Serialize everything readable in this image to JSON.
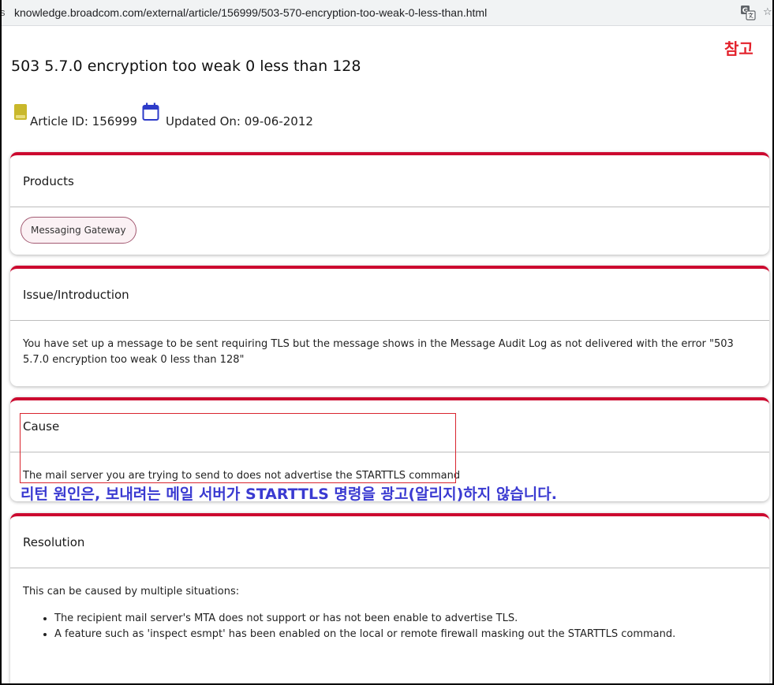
{
  "browser": {
    "url": "knowledge.broadcom.com/external/article/156999/503-570-encryption-too-weak-0-less-than.html",
    "edge_char": "s",
    "translate_icon": "translate-icon",
    "bookmark_icon": "star-icon"
  },
  "annotation": {
    "ref_label": "참고",
    "korean_note": "리턴 원인은, 보내려는 메일 서버가 STARTTLS 명령을 광고(알리지)하지 않습니다.",
    "box_color": "#d9252f",
    "note_color": "#3a3ad1"
  },
  "article": {
    "title": "503 5.7.0 encryption too weak 0 less than 128",
    "article_id": "Article ID: 156999",
    "updated_on": "Updated On: 09-06-2012",
    "accent_color": "#cc092f"
  },
  "products": {
    "heading": "Products",
    "chips": [
      "Messaging Gateway"
    ]
  },
  "issue": {
    "heading": "Issue/Introduction",
    "text": "You have set up a message to be sent requiring TLS but the message shows in the Message Audit Log as not delivered with the error \"503 5.7.0 encryption too weak 0 less than 128\""
  },
  "cause": {
    "heading": "Cause",
    "text": "The mail server you are trying to send to does not advertise the STARTTLS command"
  },
  "resolution": {
    "heading": "Resolution",
    "intro": "This can be caused by multiple situations:",
    "items": [
      "The recipient mail server's MTA does not support or has not been enable to advertise TLS.",
      "A feature such as 'inspect esmpt' has been enabled on the local or remote firewall masking out the STARTTLS command."
    ]
  }
}
